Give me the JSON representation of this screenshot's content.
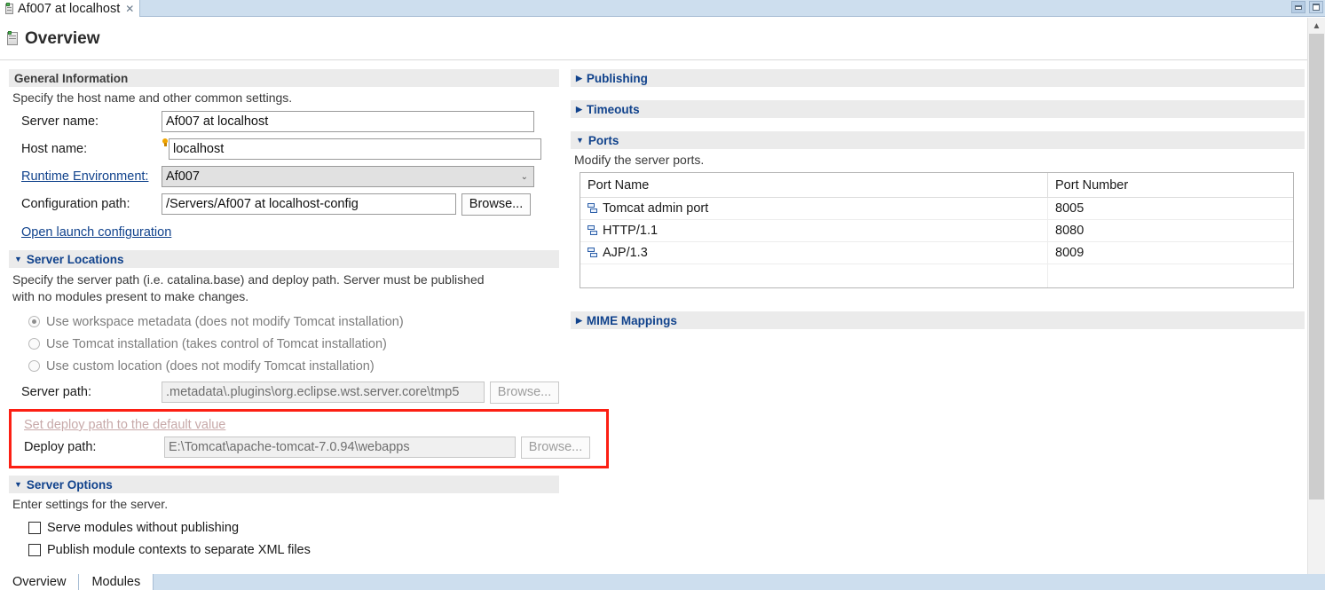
{
  "editor": {
    "tab_title": "Af007 at localhost",
    "tab_close": "✕",
    "page_title": "Overview"
  },
  "general": {
    "section_title": "General Information",
    "description": "Specify the host name and other common settings.",
    "server_name_label": "Server name:",
    "server_name_value": "Af007 at localhost",
    "host_name_label": "Host name:",
    "host_name_value": "localhost",
    "runtime_env_label": "Runtime Environment:",
    "runtime_env_value": "Af007",
    "config_path_label": "Configuration path:",
    "config_path_value": "/Servers/Af007 at localhost-config",
    "browse_label": "Browse...",
    "open_launch_config": "Open launch configuration"
  },
  "server_locations": {
    "section_title": "Server Locations",
    "description": "Specify the server path (i.e. catalina.base) and deploy path. Server must be published with no modules present to make changes.",
    "options": [
      {
        "label": "Use workspace metadata (does not modify Tomcat installation)",
        "selected": true
      },
      {
        "label": "Use Tomcat installation (takes control of Tomcat installation)",
        "selected": false
      },
      {
        "label": "Use custom location (does not modify Tomcat installation)",
        "selected": false
      }
    ],
    "server_path_label": "Server path:",
    "server_path_value": ".metadata\\.plugins\\org.eclipse.wst.server.core\\tmp5",
    "server_path_browse": "Browse...",
    "set_default_deploy_link": "Set deploy path to the default value",
    "deploy_path_label": "Deploy path:",
    "deploy_path_value": "E:\\Tomcat\\apache-tomcat-7.0.94\\webapps",
    "deploy_path_browse": "Browse...",
    "highlight_color": "#fc1f13"
  },
  "server_options": {
    "section_title": "Server Options",
    "description": "Enter settings for the server.",
    "checkboxes": [
      {
        "label": "Serve modules without publishing",
        "checked": false
      },
      {
        "label": "Publish module contexts to separate XML files",
        "checked": false
      }
    ]
  },
  "right": {
    "publishing_title": "Publishing",
    "timeouts_title": "Timeouts",
    "ports_title": "Ports",
    "ports_description": "Modify the server ports.",
    "mime_title": "MIME Mappings",
    "ports_table": {
      "columns": [
        "Port Name",
        "Port Number"
      ],
      "rows": [
        {
          "name": "Tomcat admin port",
          "number": "8005"
        },
        {
          "name": "HTTP/1.1",
          "number": "8080"
        },
        {
          "name": "AJP/1.3",
          "number": "8009"
        }
      ]
    }
  },
  "bottom_tabs": [
    {
      "label": "Overview",
      "selected": true
    },
    {
      "label": "Modules",
      "selected": false
    }
  ],
  "scrollbar": {
    "up_arrow": "▲",
    "down_arrow": "▼"
  },
  "twisty": {
    "expanded": "▼",
    "collapsed": "▶"
  }
}
